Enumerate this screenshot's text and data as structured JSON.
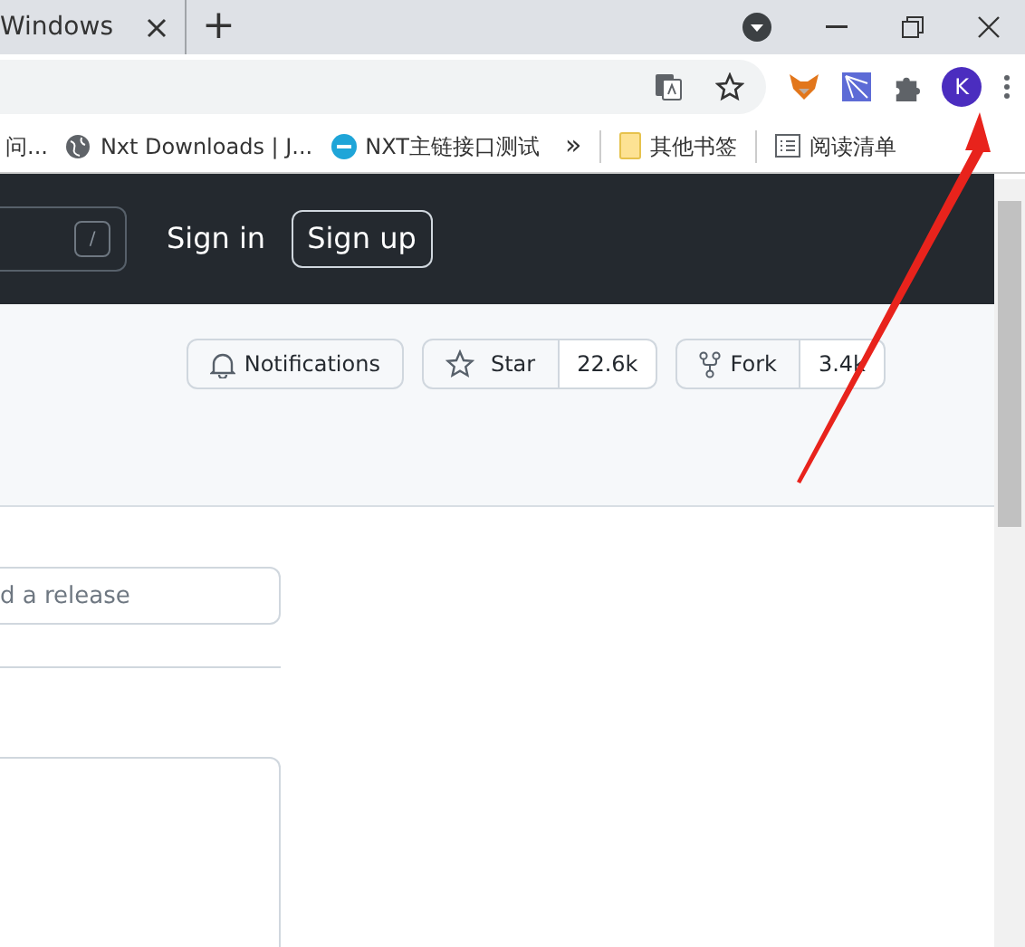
{
  "browser": {
    "tab": {
      "title": "Windows"
    },
    "new_tab": "+",
    "bookmarks": [
      {
        "kind": "text",
        "label": "问..."
      },
      {
        "kind": "globe",
        "label": "Nxt Downloads | J..."
      },
      {
        "kind": "site",
        "label": "NXT主链接口测试"
      },
      {
        "kind": "more",
        "label": "»"
      },
      {
        "kind": "folder",
        "label": "其他书签"
      },
      {
        "kind": "reading",
        "label": "阅读清单"
      }
    ],
    "avatar": "K"
  },
  "header": {
    "search_key": "/",
    "sign_in": "Sign in",
    "sign_up": "Sign up"
  },
  "repo_actions": {
    "notifications": "Notifications",
    "star": "Star",
    "star_count": "22.6k",
    "fork": "Fork",
    "fork_count": "3.4k"
  },
  "form": {
    "placeholder": "d a release"
  }
}
